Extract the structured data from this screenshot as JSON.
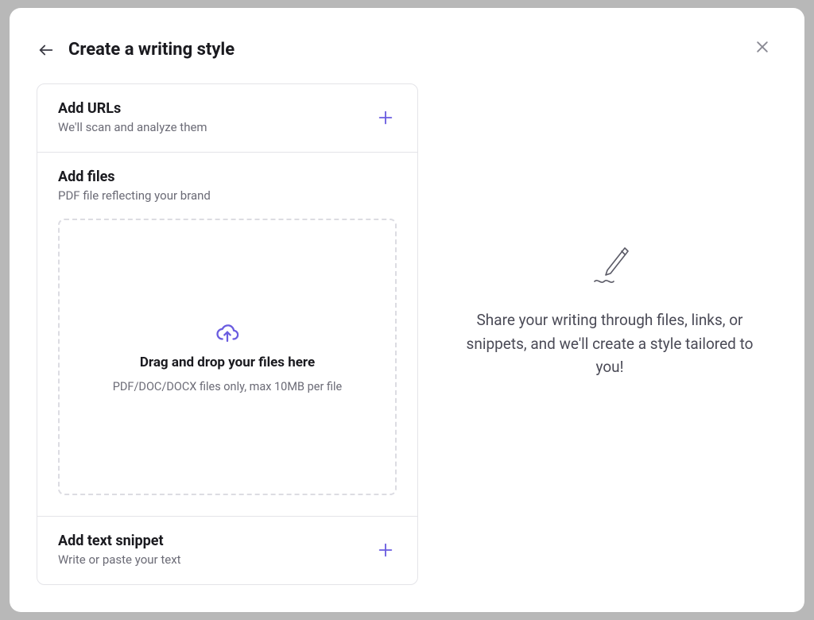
{
  "header": {
    "title": "Create a writing style"
  },
  "sections": {
    "urls": {
      "title": "Add URLs",
      "subtitle": "We'll scan and analyze them"
    },
    "files": {
      "title": "Add files",
      "subtitle": "PDF file reflecting your brand",
      "dropzone": {
        "title": "Drag and drop your files here",
        "subtitle": "PDF/DOC/DOCX files only, max 10MB per file"
      }
    },
    "snippet": {
      "title": "Add text snippet",
      "subtitle": "Write or paste your text"
    }
  },
  "right": {
    "description": "Share your writing through files, links, or snippets, and we'll create a style tailored to you!"
  }
}
